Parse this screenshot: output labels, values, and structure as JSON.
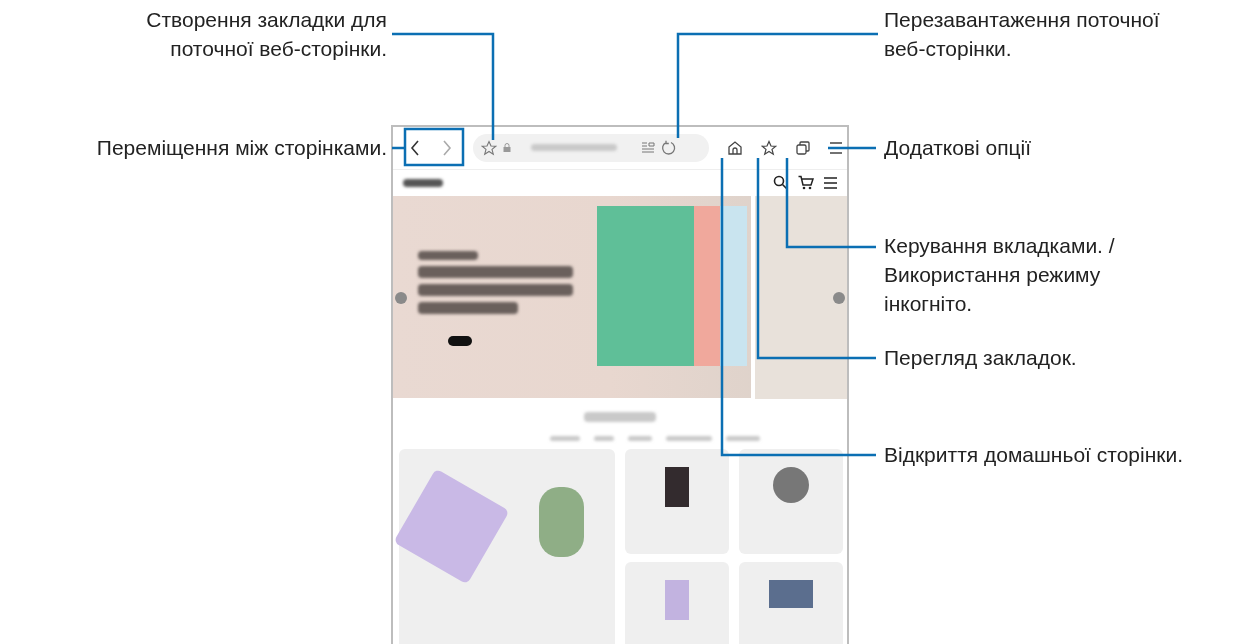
{
  "callouts": [
    {
      "kind": "left",
      "lines": [
        "Створення закладки для",
        "поточної веб-сторінки."
      ]
    },
    {
      "kind": "left",
      "lines": [
        "Переміщення між сторінками."
      ]
    },
    {
      "kind": "right",
      "lines": [
        "Перезавантаження поточної",
        "веб-сторінки."
      ]
    },
    {
      "kind": "right",
      "lines": [
        "Додаткові опції"
      ]
    },
    {
      "kind": "right",
      "lines": [
        "Керування вкладками. /",
        "Використання режиму",
        "інкогніто."
      ]
    },
    {
      "kind": "right",
      "lines": [
        "Перегляд закладок."
      ]
    },
    {
      "kind": "right",
      "lines": [
        "Відкриття домашньої сторінки."
      ]
    }
  ],
  "browser": {
    "nav_buttons": [
      {
        "kind": "back",
        "disabled": false
      },
      {
        "kind": "forward",
        "disabled": true
      }
    ]
  }
}
